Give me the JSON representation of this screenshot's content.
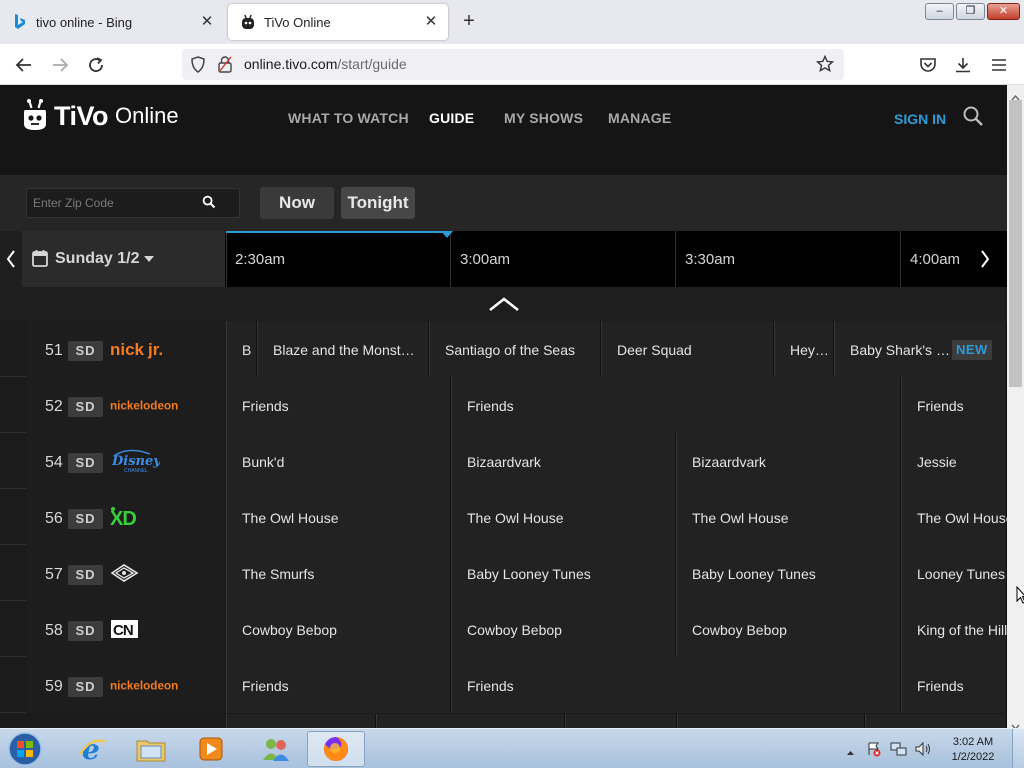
{
  "browser": {
    "tabs": [
      {
        "title": "tivo online - Bing",
        "active": false
      },
      {
        "title": "TiVo Online",
        "active": true
      }
    ],
    "url": {
      "host": "online.tivo.com",
      "path": "/start/guide"
    },
    "window_controls": {
      "minimize": "–",
      "maximize": "❐",
      "close": "✕"
    },
    "new_tab": "+"
  },
  "site": {
    "logo_word": "TiVo",
    "logo_sub": "Online",
    "nav": [
      "WHAT TO WATCH",
      "GUIDE",
      "MY SHOWS",
      "MANAGE"
    ],
    "active_nav": "GUIDE",
    "sign_in": "SIGN IN",
    "accent_color": "#2e9bd6"
  },
  "controls": {
    "zip_placeholder": "Enter Zip Code",
    "now_label": "Now",
    "tonight_label": "Tonight"
  },
  "guide": {
    "date": "Sunday 1/2",
    "time_slots": [
      "2:30am",
      "3:00am",
      "3:30am",
      "4:00am"
    ],
    "rows": [
      {
        "number": "51",
        "quality": "SD",
        "network": "nick jr.",
        "logo": "nickjr-logo",
        "shows": [
          {
            "title": "B"
          },
          {
            "title": "Blaze and the Monster …"
          },
          {
            "title": "Santiago of the Seas"
          },
          {
            "title": "Deer Squad"
          },
          {
            "title": "Hey…"
          },
          {
            "title": "Baby Shark's B…",
            "badge": "NEW"
          }
        ]
      },
      {
        "number": "52",
        "quality": "SD",
        "network": "nickelodeon",
        "logo": "nickelodeon-logo",
        "shows": [
          {
            "title": "Friends"
          },
          {
            "title": "Friends"
          },
          {
            "title": "Friends"
          }
        ]
      },
      {
        "number": "54",
        "quality": "SD",
        "network": "Disney Channel",
        "logo": "disney-channel-logo",
        "shows": [
          {
            "title": "Bunk'd"
          },
          {
            "title": "Bizaardvark"
          },
          {
            "title": "Bizaardvark"
          },
          {
            "title": "Jessie"
          }
        ]
      },
      {
        "number": "56",
        "quality": "SD",
        "network": "Disney XD",
        "logo": "disney-xd-logo",
        "shows": [
          {
            "title": "The Owl House"
          },
          {
            "title": "The Owl House"
          },
          {
            "title": "The Owl House"
          },
          {
            "title": "The Owl House"
          }
        ]
      },
      {
        "number": "57",
        "quality": "SD",
        "network": "Boomerang",
        "logo": "boomerang-logo",
        "shows": [
          {
            "title": "The Smurfs"
          },
          {
            "title": "Baby Looney Tunes"
          },
          {
            "title": "Baby Looney Tunes"
          },
          {
            "title": "Looney Tunes"
          }
        ]
      },
      {
        "number": "58",
        "quality": "SD",
        "network": "Cartoon Network",
        "logo": "cartoon-network-logo",
        "shows": [
          {
            "title": "Cowboy Bebop"
          },
          {
            "title": "Cowboy Bebop"
          },
          {
            "title": "Cowboy Bebop"
          },
          {
            "title": "King of the Hill"
          }
        ]
      },
      {
        "number": "59",
        "quality": "SD",
        "network": "nickelodeon",
        "logo": "nickelodeon-logo",
        "shows": [
          {
            "title": "Friends"
          },
          {
            "title": "Friends"
          },
          {
            "title": "Friends"
          }
        ]
      }
    ]
  },
  "taskbar": {
    "time": "3:02 AM",
    "date": "1/2/2022",
    "apps": [
      "internet-explorer",
      "windows-explorer",
      "media-player",
      "people",
      "firefox"
    ]
  }
}
